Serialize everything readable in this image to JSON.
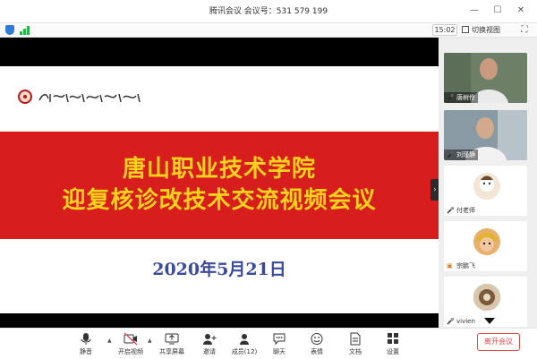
{
  "window": {
    "title": "腾讯会议  会议号：531 579 199",
    "minimize": "—",
    "maximize": "☐",
    "close": "✕"
  },
  "statusbar": {
    "clock": "15:02",
    "switch_view": "切换视图",
    "fullscreen": "⛶"
  },
  "slide": {
    "title_line1": "唐山职业技术学院",
    "title_line2": "迎复核诊改技术交流视频会议",
    "date": "2020年5月21日",
    "collapse": "›"
  },
  "participants": [
    {
      "name": "唐树伶",
      "type": "video",
      "colors": {
        "bg": "#6e7f68",
        "face": "#c99a7e",
        "shirt": "#e9e9e9"
      }
    },
    {
      "name": "刘瑾静",
      "type": "video",
      "colors": {
        "bg": "#8a9aa4",
        "face": "#d3a98c",
        "shirt": "#f2f2f2"
      }
    },
    {
      "name": "付老师",
      "type": "avatar",
      "colors": {
        "bg": "#ffffff",
        "avatar": "#f4e6d6"
      }
    },
    {
      "name": "宗鹏飞",
      "type": "avatar",
      "colors": {
        "bg": "#ffffff",
        "avatar": "#e8b06a"
      }
    },
    {
      "name": "vivien",
      "type": "avatar",
      "colors": {
        "bg": "#ffffff",
        "avatar": "#8b6b4a"
      }
    }
  ],
  "toolbar": {
    "mute": "静音",
    "start_video": "开启视频",
    "share_screen": "共享屏幕",
    "invite": "邀请",
    "members": "成员(12)",
    "chat": "聊天",
    "emoji": "表情",
    "docs": "文档",
    "settings": "设置",
    "leave": "离开会议"
  },
  "colors": {
    "red_band": "#d71e1c",
    "title_yellow": "#f7d21c",
    "date_blue": "#3b4a9c",
    "leave_red": "#e04b4b"
  }
}
